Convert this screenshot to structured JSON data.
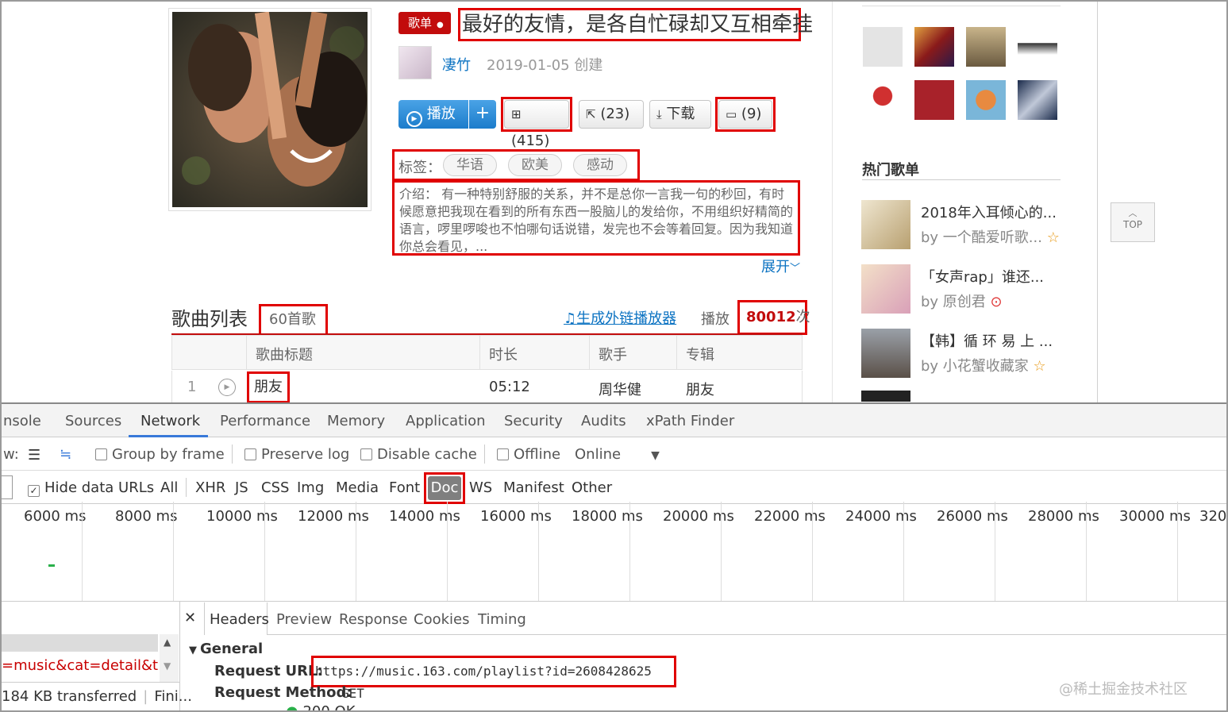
{
  "playlist": {
    "badge": "歌单",
    "title": "最好的友情，是各自忙碌却又互相牵挂",
    "creator": "凄竹",
    "created": "2019-01-05 创建",
    "play_label": "播放",
    "add_label": "+",
    "collect_count": "(415)",
    "share_count": "(23)",
    "download_label": "下载",
    "comment_count": "(9)",
    "tags_label": "标签：",
    "tags": [
      "华语",
      "欧美",
      "感动"
    ],
    "intro": "介绍： 有一种特别舒服的关系，并不是总你一言我一句的秒回，有时候愿意把我现在看到的所有东西一股脑儿的发给你，不用组织好精简的语言，啰里啰唆也不怕哪句话说错，发完也不会等着回复。因为我知道你总会看见，...",
    "expand": "展开"
  },
  "songlist": {
    "heading": "歌曲列表",
    "count": "60首歌",
    "external_player": "生成外链播放器",
    "plays_label": "播放",
    "plays_value": "80012",
    "plays_unit": "次",
    "columns": [
      "歌曲标题",
      "时长",
      "歌手",
      "专辑"
    ],
    "rows": [
      {
        "index": "1",
        "title": "朋友",
        "duration": "05:12",
        "artist": "周华健",
        "album": "朋友"
      }
    ]
  },
  "sidebar": {
    "hot_heading": "热门歌单",
    "hot": [
      {
        "title": "2018年入耳倾心的...",
        "by": "by 一个酷爱听歌..."
      },
      {
        "title": "「女声rap」谁还...",
        "by": "by 原创君"
      },
      {
        "title": "【韩】循 环 易 上 ...",
        "by": "by 小花蟹收藏家"
      }
    ],
    "top_label": "TOP"
  },
  "devtools": {
    "tabs": [
      "nsole",
      "Sources",
      "Network",
      "Performance",
      "Memory",
      "Application",
      "Security",
      "Audits",
      "xPath Finder"
    ],
    "active_tab": "Network",
    "toolbar": {
      "view_label": "w:",
      "group_by_frame": "Group by frame",
      "preserve_log": "Preserve log",
      "disable_cache": "Disable cache",
      "offline": "Offline",
      "throttle": "Online"
    },
    "filter": {
      "hide_data_urls": "Hide data URLs",
      "types": [
        "All",
        "XHR",
        "JS",
        "CSS",
        "Img",
        "Media",
        "Font",
        "Doc",
        "WS",
        "Manifest",
        "Other"
      ],
      "active_type": "Doc"
    },
    "ticks": [
      "6000 ms",
      "8000 ms",
      "10000 ms",
      "12000 ms",
      "14000 ms",
      "16000 ms",
      "18000 ms",
      "20000 ms",
      "22000 ms",
      "24000 ms",
      "26000 ms",
      "28000 ms",
      "30000 ms",
      "320"
    ],
    "request_name": "=music&cat=detail&typ",
    "transferred": "184 KB transferred",
    "finish": "Fini...",
    "detail_tabs": [
      "Headers",
      "Preview",
      "Response",
      "Cookies",
      "Timing"
    ],
    "general_label": "General",
    "request_url_label": "Request URL:",
    "request_url": "https://music.163.com/playlist?id=2608428625",
    "request_method_label": "Request Method:",
    "request_method": "GET",
    "status_partial": "200 OK"
  },
  "watermark": "@稀土掘金技术社区"
}
